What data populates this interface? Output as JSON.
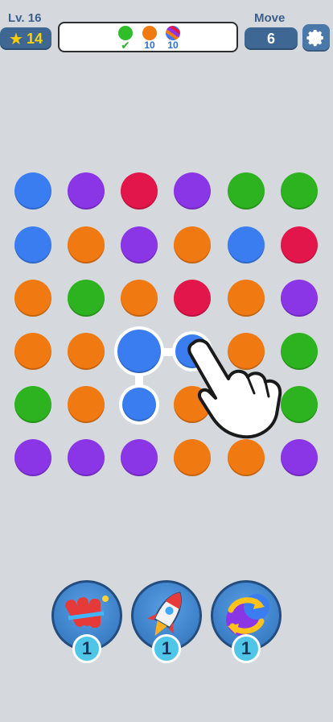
{
  "header": {
    "level_label": "Lv. 16",
    "stars": "14",
    "move_label": "Move",
    "moves": "6"
  },
  "goals": [
    {
      "color": "#2fbe2a",
      "count": "✔"
    },
    {
      "color": "#f07a12",
      "count": "10"
    },
    {
      "color": "striped",
      "count": "10"
    }
  ],
  "palette": {
    "blue": "#3a7df0",
    "purple": "#8a35e6",
    "red": "#e3164b",
    "green": "#2db31f",
    "orange": "#f07912"
  },
  "grid": [
    [
      "blue",
      "purple",
      "red",
      "purple",
      "green",
      "green"
    ],
    [
      "blue",
      "orange",
      "purple",
      "orange",
      "blue",
      "red"
    ],
    [
      "orange",
      "green",
      "orange",
      "red",
      "orange",
      "purple"
    ],
    [
      "orange",
      "orange",
      "blue",
      "blue",
      "orange",
      "green"
    ],
    [
      "green",
      "orange",
      "blue",
      "orange",
      "orange",
      "green"
    ],
    [
      "purple",
      "purple",
      "purple",
      "orange",
      "orange",
      "purple"
    ]
  ],
  "boosters": [
    {
      "icon": "firecracker-icon",
      "count": "1"
    },
    {
      "icon": "rocket-icon",
      "count": "1"
    },
    {
      "icon": "shuffle-icon",
      "count": "1"
    }
  ]
}
